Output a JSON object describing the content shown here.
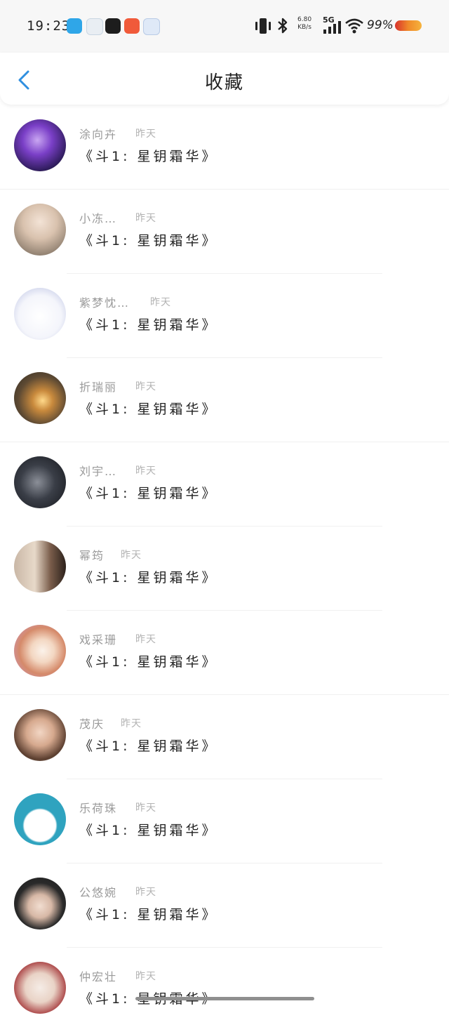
{
  "status_bar": {
    "time": "19:23",
    "net_speed_value": "6.80",
    "net_speed_unit": "KB/s",
    "network": "5G",
    "battery_percent": "99%"
  },
  "nav": {
    "title": "收藏",
    "back_icon": "chevron-left-icon"
  },
  "items": [
    {
      "name": "涂向卉",
      "time": "昨天",
      "title": "《斗1: 星钥霜华》"
    },
    {
      "name": "小冻…",
      "time": "昨天",
      "title": "《斗1: 星钥霜华》"
    },
    {
      "name": "紫梦忱…",
      "time": "昨天",
      "title": "《斗1: 星钥霜华》"
    },
    {
      "name": "折瑞丽",
      "time": "昨天",
      "title": "《斗1: 星钥霜华》"
    },
    {
      "name": "刘宇…",
      "time": "昨天",
      "title": "《斗1: 星钥霜华》"
    },
    {
      "name": "幂筠",
      "time": "昨天",
      "title": "《斗1: 星钥霜华》"
    },
    {
      "name": "戏采珊",
      "time": "昨天",
      "title": "《斗1: 星钥霜华》"
    },
    {
      "name": "茂庆",
      "time": "昨天",
      "title": "《斗1: 星钥霜华》"
    },
    {
      "name": "乐荷珠",
      "time": "昨天",
      "title": "《斗1: 星钥霜华》"
    },
    {
      "name": "公悠婉",
      "time": "昨天",
      "title": "《斗1: 星钥霜华》"
    },
    {
      "name": "仲宏壮",
      "time": "昨天",
      "title": "《斗1: 星钥霜华》"
    }
  ],
  "colors": {
    "accent": "#2f8fe0",
    "battery": "#e8642c"
  }
}
